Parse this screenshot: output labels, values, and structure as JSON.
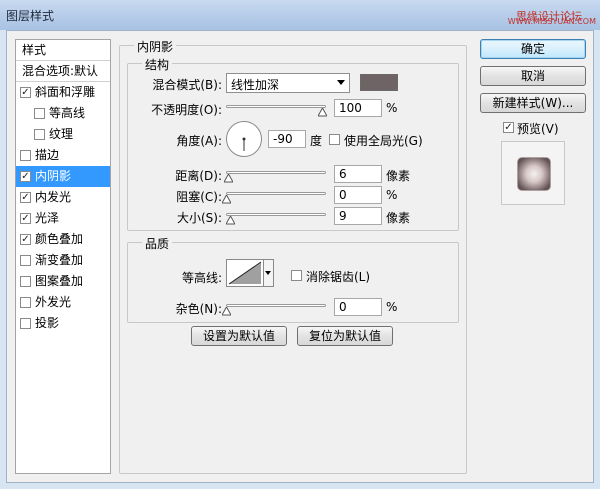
{
  "window": {
    "title": "图层样式",
    "watermark": "思缘设计论坛",
    "watermark_url": "WWW.MISSYUAN.COM"
  },
  "styles_list": {
    "header": "样式",
    "blend_options": "混合选项:默认",
    "items": [
      {
        "label": "斜面和浮雕",
        "checked": true,
        "selected": false,
        "sub": false
      },
      {
        "label": "等高线",
        "checked": false,
        "selected": false,
        "sub": true
      },
      {
        "label": "纹理",
        "checked": false,
        "selected": false,
        "sub": true
      },
      {
        "label": "描边",
        "checked": false,
        "selected": false,
        "sub": false
      },
      {
        "label": "内阴影",
        "checked": true,
        "selected": true,
        "sub": false
      },
      {
        "label": "内发光",
        "checked": true,
        "selected": false,
        "sub": false
      },
      {
        "label": "光泽",
        "checked": true,
        "selected": false,
        "sub": false
      },
      {
        "label": "颜色叠加",
        "checked": true,
        "selected": false,
        "sub": false
      },
      {
        "label": "渐变叠加",
        "checked": false,
        "selected": false,
        "sub": false
      },
      {
        "label": "图案叠加",
        "checked": false,
        "selected": false,
        "sub": false
      },
      {
        "label": "外发光",
        "checked": false,
        "selected": false,
        "sub": false
      },
      {
        "label": "投影",
        "checked": false,
        "selected": false,
        "sub": false
      }
    ]
  },
  "inner_shadow": {
    "title": "内阴影",
    "structure_title": "结构",
    "blend_mode_label": "混合模式(B):",
    "blend_mode_value": "线性加深",
    "color": "#6e6466",
    "opacity_label": "不透明度(O):",
    "opacity_value": "100",
    "opacity_unit": "%",
    "opacity_level": 1.0,
    "angle_label": "角度(A):",
    "angle_value": "-90",
    "angle_unit": "度",
    "global_light_label": "使用全局光(G)",
    "global_light_checked": false,
    "distance_label": "距离(D):",
    "distance_value": "6",
    "distance_unit": "像素",
    "distance_level": 0.02,
    "choke_label": "阻塞(C):",
    "choke_value": "0",
    "choke_unit": "%",
    "choke_level": 0.0,
    "size_label": "大小(S):",
    "size_value": "9",
    "size_unit": "像素",
    "size_level": 0.04,
    "quality_title": "品质",
    "contour_label": "等高线:",
    "antialias_label": "消除锯齿(L)",
    "antialias_checked": false,
    "noise_label": "杂色(N):",
    "noise_value": "0",
    "noise_unit": "%",
    "noise_level": 0.0,
    "make_default": "设置为默认值",
    "reset_default": "复位为默认值"
  },
  "buttons": {
    "ok": "确定",
    "cancel": "取消",
    "new_style": "新建样式(W)...",
    "preview_label": "预览(V)",
    "preview_checked": true
  }
}
